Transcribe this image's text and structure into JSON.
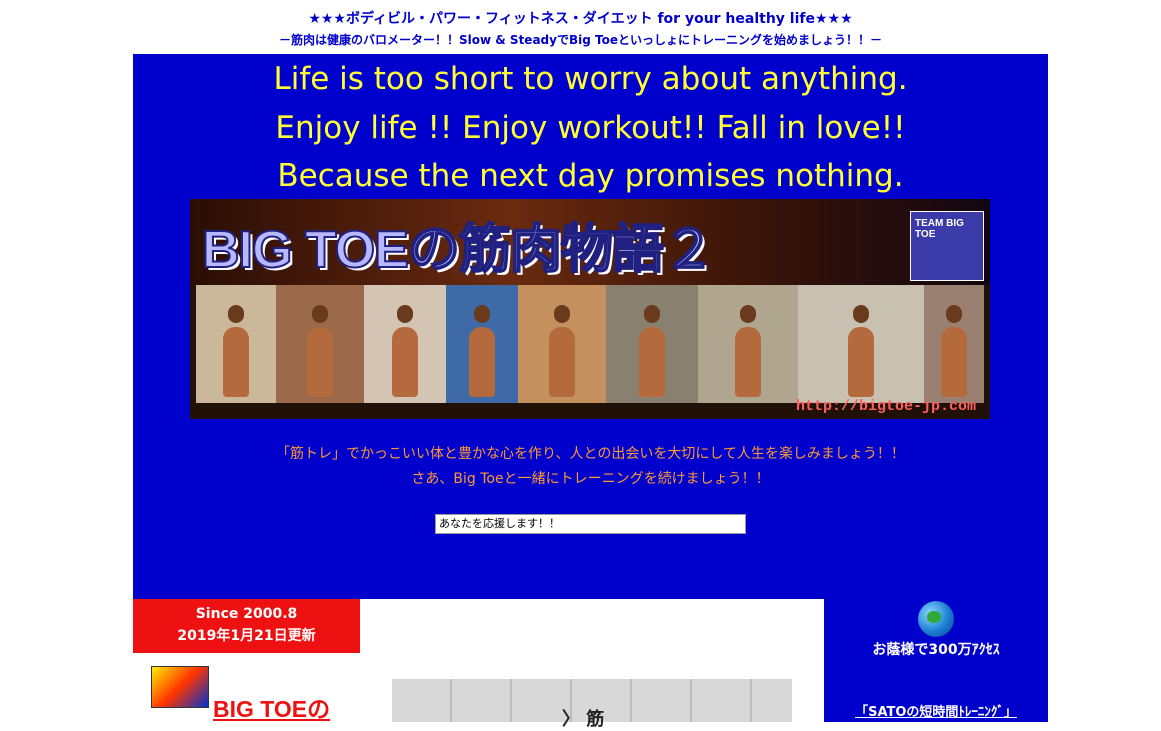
{
  "header": {
    "tagline_stars_left": "★★★",
    "tagline_text": "ボディビル・パワー・フィットネス・ダイエット for your healthy life",
    "tagline_stars_right": "★★★",
    "subtagline": "－筋肉は健康のバロメーター！！Slow & SteadyでBig Toeといっしょにトレーニングを始めましょう！！－"
  },
  "hero": {
    "quotes": [
      "Life is too short to worry about anything.",
      "Enjoy life !! Enjoy workout!! Fall in love!!",
      "Because the next day promises nothing."
    ],
    "banner": {
      "title": "BIG TOEの筋肉物語２",
      "team_logo": "TEAM BIG TOE",
      "url": "http://bigtoe-jp.com"
    },
    "messages": [
      "「筋トレ」でかっこいい体と豊かな心を作り、人との出会いを大切にして人生を楽しみましょう！！",
      "さあ、Big Toeと一緒にトレーニングを続けましょう！！"
    ],
    "cheer_box_value": "あなたを応援します！！"
  },
  "sidebar_left": {
    "since": "Since 2000.8",
    "updated": "2019年1月21日更新",
    "title_link": "BIG TOEの"
  },
  "main": {
    "photo_sign": "〉 筋"
  },
  "sidebar_right": {
    "access": "お蔭様で300万ｱｸｾｽ",
    "sato_link": "「SATOの短時間ﾄﾚｰﾆﾝｸﾞ」"
  },
  "colors": {
    "hero_bg": "#0000cc",
    "quote_text": "#ffff33",
    "message_text": "#ff9933",
    "since_bg": "#ee1111"
  },
  "banner_photo_colors": [
    "#cbb79a",
    "#9a6a4a",
    "#d4c4b4",
    "#3e6aa8",
    "#c4905e",
    "#8a8070",
    "#b0a690",
    "#c8c0b0",
    "#9a8070"
  ]
}
